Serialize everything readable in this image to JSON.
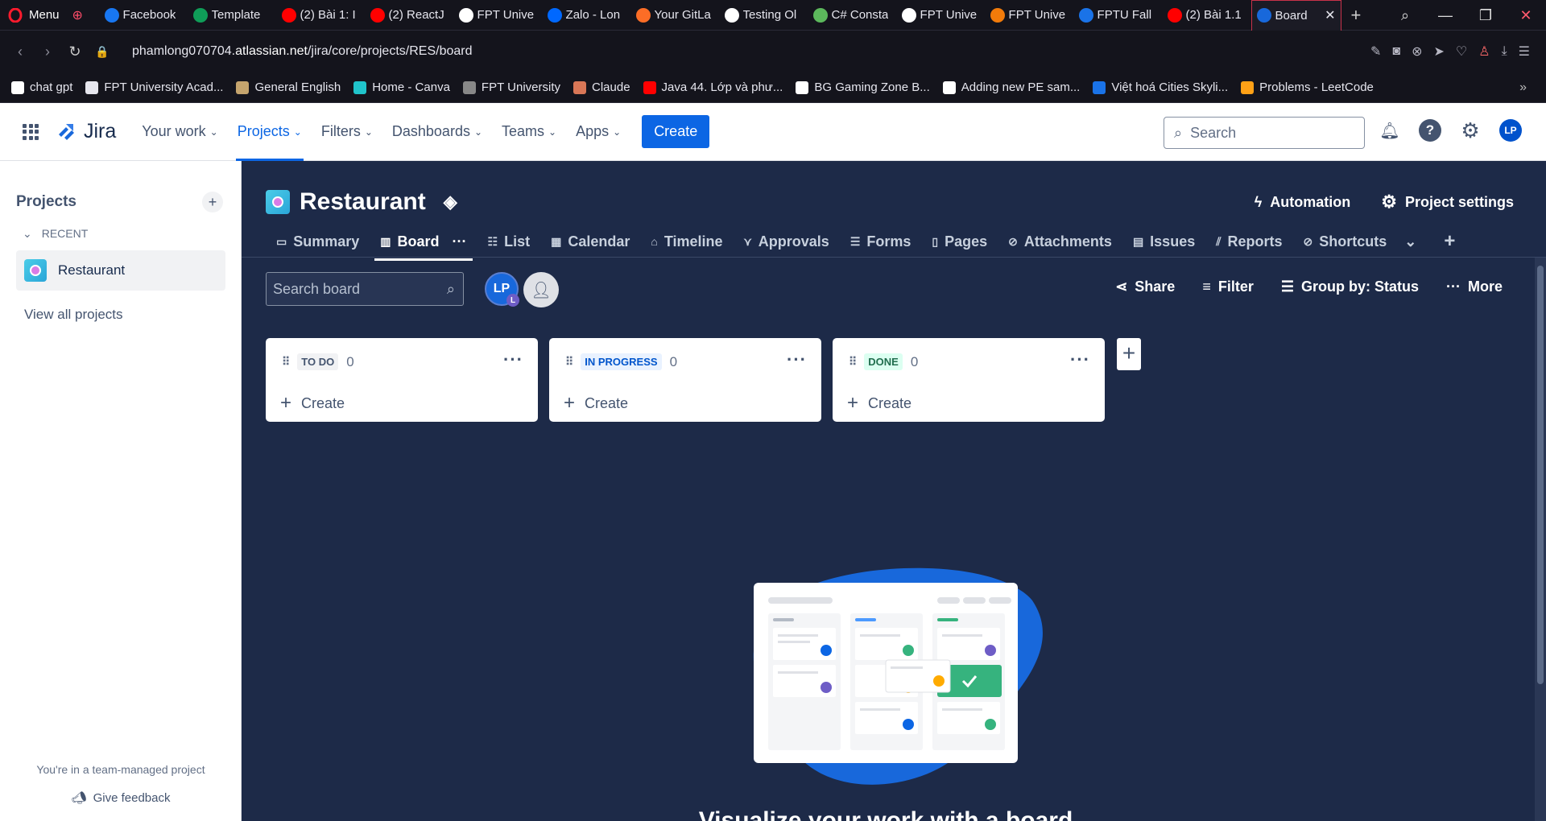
{
  "browser": {
    "menu_label": "Menu",
    "tabs": [
      {
        "label": "Facebook",
        "color": "#1877f2"
      },
      {
        "label": "Template",
        "color": "#0f9d58"
      },
      {
        "label": "(2) Bài 1: I",
        "color": "#ff0000"
      },
      {
        "label": "(2) ReactJ",
        "color": "#ff0000"
      },
      {
        "label": "FPT Unive",
        "color": "#ffffff"
      },
      {
        "label": "Zalo - Lon",
        "color": "#0068ff"
      },
      {
        "label": "Your GitLa",
        "color": "#fc6d26"
      },
      {
        "label": "Testing Ol",
        "color": "#ffffff"
      },
      {
        "label": "C# Consta",
        "color": "#5cb85c"
      },
      {
        "label": "FPT Unive",
        "color": "#ffffff"
      },
      {
        "label": "FPT Unive",
        "color": "#f27b0a"
      },
      {
        "label": "FPTU Fall",
        "color": "#1a73e8"
      },
      {
        "label": "(2) Bài 1.1",
        "color": "#ff0000"
      },
      {
        "label": "Board",
        "color": "#1868db"
      }
    ],
    "url_prefix": "phamlong070704.",
    "url_domain": "atlassian.net",
    "url_path": "/jira/core/projects/RES/board",
    "bookmarks": [
      {
        "label": "chat gpt",
        "color": "#ffffff"
      },
      {
        "label": "FPT University Acad...",
        "color": "#e6e6ee"
      },
      {
        "label": "General English",
        "color": "#c5a46d"
      },
      {
        "label": "Home - Canva",
        "color": "#20c4cb"
      },
      {
        "label": "FPT University",
        "color": "#888888"
      },
      {
        "label": "Claude",
        "color": "#d97757"
      },
      {
        "label": "Java 44. Lớp và phư...",
        "color": "#ff0000"
      },
      {
        "label": "BG Gaming Zone B...",
        "color": "#ffffff"
      },
      {
        "label": "Adding new PE sam...",
        "color": "#ffffff"
      },
      {
        "label": "Việt hoá Cities Skyli...",
        "color": "#1a73e8"
      },
      {
        "label": "Problems - LeetCode",
        "color": "#ffa116"
      }
    ]
  },
  "jira": {
    "logo_text": "Jira",
    "nav": [
      "Your work",
      "Projects",
      "Filters",
      "Dashboards",
      "Teams",
      "Apps"
    ],
    "create_label": "Create",
    "search_placeholder": "Search",
    "avatar_initials": "LP"
  },
  "sidebar": {
    "title": "Projects",
    "recent_label": "RECENT",
    "project_name": "Restaurant",
    "view_all": "View all projects",
    "footer_note": "You're in a team-managed project",
    "feedback": "Give feedback"
  },
  "project": {
    "name": "Restaurant",
    "automation": "Automation",
    "settings": "Project settings",
    "tabs": [
      "Summary",
      "Board",
      "List",
      "Calendar",
      "Timeline",
      "Approvals",
      "Forms",
      "Pages",
      "Attachments",
      "Issues",
      "Reports",
      "Shortcuts"
    ]
  },
  "board": {
    "search_placeholder": "Search board",
    "avatar_initials": "LP",
    "avatar_badge": "L",
    "share": "Share",
    "filter": "Filter",
    "group_by": "Group by: Status",
    "more": "More",
    "columns": [
      {
        "name": "TO DO",
        "count": "0",
        "create": "Create",
        "label_bg": "#f1f2f4",
        "label_fg": "#44546f"
      },
      {
        "name": "IN PROGRESS",
        "count": "0",
        "create": "Create",
        "label_bg": "#e9f2ff",
        "label_fg": "#0055cc"
      },
      {
        "name": "DONE",
        "count": "0",
        "create": "Create",
        "label_bg": "#dcfff1",
        "label_fg": "#216e4e"
      }
    ],
    "empty_title": "Visualize your work with a board"
  }
}
